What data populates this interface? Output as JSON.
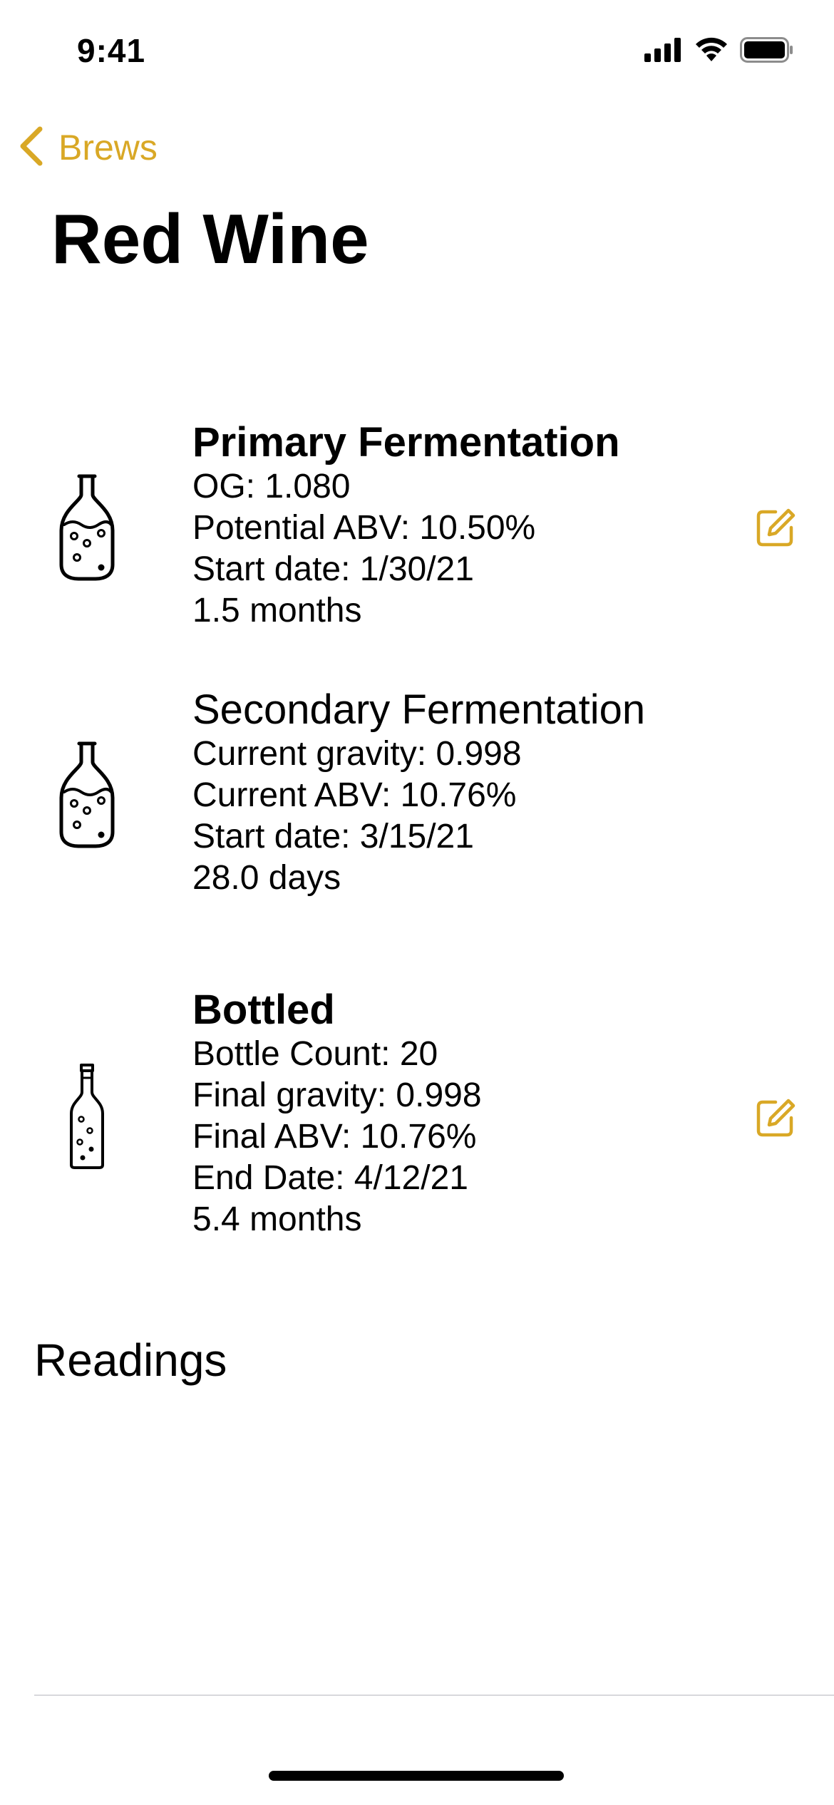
{
  "colors": {
    "accent": "#D9A826",
    "text": "#000000",
    "divider": "#D8D8DC",
    "background": "#FFFFFF"
  },
  "status_bar": {
    "time": "9:41",
    "icons": [
      "cellular-signal-icon",
      "wifi-icon",
      "battery-icon"
    ]
  },
  "nav": {
    "back_label": "Brews",
    "back_icon": "chevron-left-icon"
  },
  "title": "Red Wine",
  "stages": [
    {
      "title": "Primary Fermentation",
      "icon": "carboy-icon",
      "editable": true,
      "lines": [
        "OG: 1.080",
        "Potential ABV: 10.50%",
        "Start date: 1/30/21",
        "1.5 months"
      ]
    },
    {
      "title": "Secondary Fermentation",
      "icon": "carboy-icon",
      "editable": false,
      "lines": [
        "Current gravity: 0.998",
        "Current ABV: 10.76%",
        "Start date: 3/15/21",
        "28.0 days"
      ]
    },
    {
      "title": "Bottled",
      "icon": "bottle-icon",
      "editable": true,
      "lines": [
        "Bottle Count: 20",
        "Final gravity: 0.998",
        "Final ABV: 10.76%",
        "End Date: 4/12/21",
        "5.4 months"
      ]
    }
  ],
  "readings": {
    "heading": "Readings"
  }
}
